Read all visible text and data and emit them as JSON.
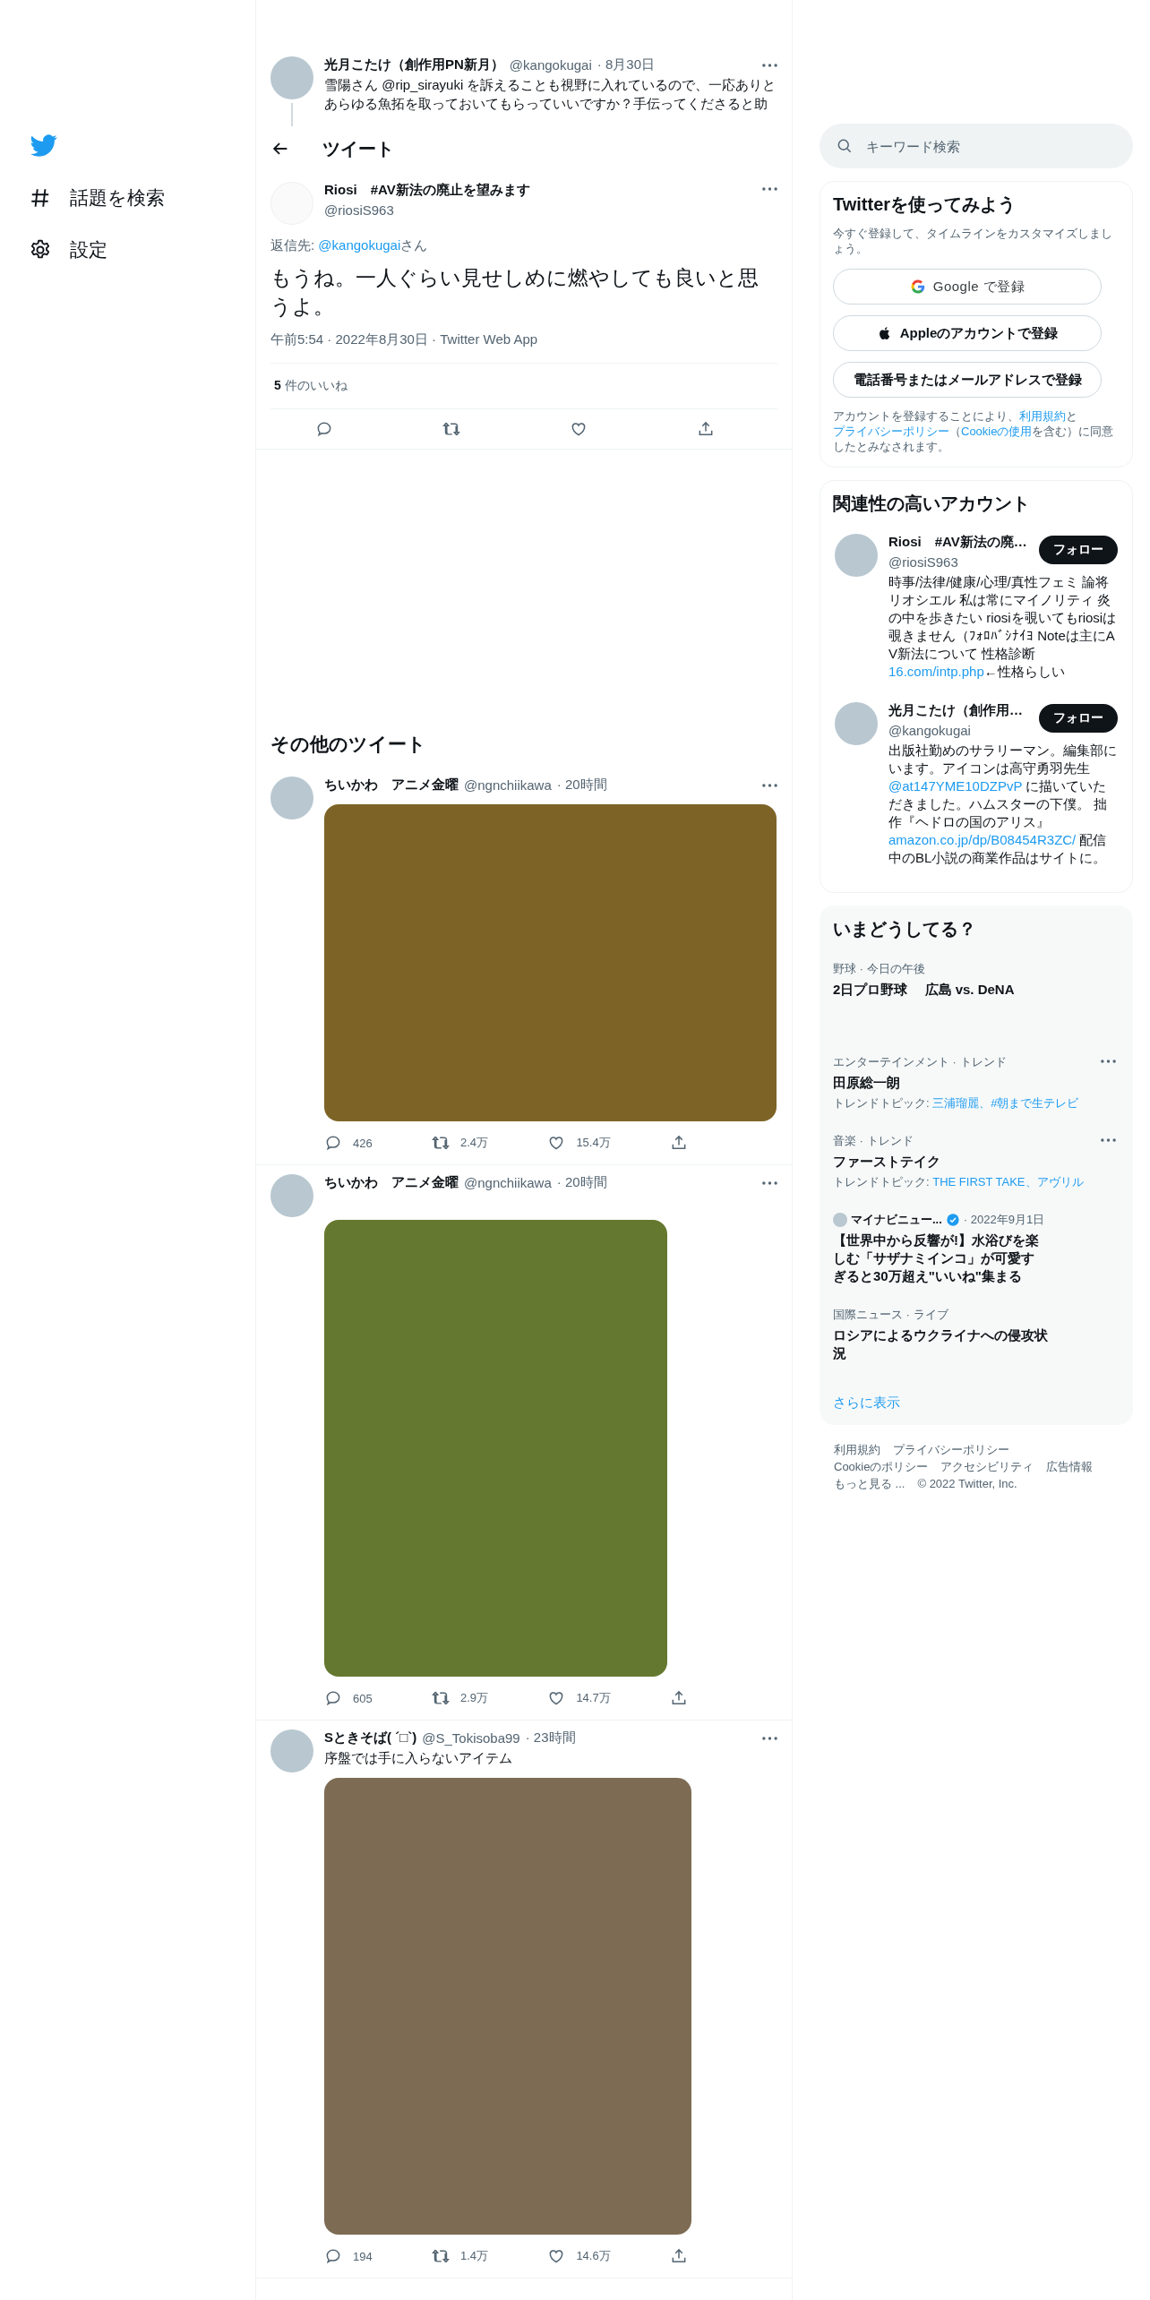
{
  "sidebar": {
    "items": [
      {
        "kind": "explore",
        "label": "話題を検索"
      },
      {
        "kind": "settings",
        "label": "設定"
      }
    ]
  },
  "parent_tweet": {
    "name": "光月こたけ（創作用PN新月）",
    "handle": "@kangokugai",
    "date": "· 8月30日",
    "text": "雪陽さん @rip_sirayuki を訴えることも視野に入れているので、一応ありとあらゆる魚拓を取っておいてもらっていいですか？手伝ってくださると助"
  },
  "header": {
    "title": "ツイート"
  },
  "main_tweet": {
    "name": "Riosi　#AV新法の廃止を望みます",
    "handle": "@riosiS963",
    "reply_prefix": "返信先: ",
    "reply_handle": "@kangokugai",
    "reply_suffix": "さん",
    "text": "もうね。一人ぐらい見せしめに燃やしても良いと思うよ。",
    "meta": "午前5:54 · 2022年8月30日 · Twitter Web App",
    "likes_count": "5",
    "likes_label": "件のいいね"
  },
  "more_tweets": {
    "title": "その他のツイート",
    "tweets": [
      {
        "name": "ちいかわ　アニメ金曜",
        "handle": "@ngnchiikawa",
        "time": "· 20時間",
        "media": {
          "color": "#7d6426"
        },
        "replies": "426",
        "retweets": "2.4万",
        "likes": "15.4万"
      },
      {
        "name": "ちいかわ　アニメ金曜",
        "handle": "@ngnchiikawa",
        "time": "· 20時間",
        "media": {
          "color": "#65782f"
        },
        "replies": "605",
        "retweets": "2.9万",
        "likes": "14.7万"
      },
      {
        "name": "Sときそば( ´□`)",
        "handle": "@S_Tokisoba99",
        "time": "· 23時間",
        "text": "序盤では手に入らないアイテム",
        "media": {
          "color": "#7d6b53"
        },
        "replies": "194",
        "retweets": "1.4万",
        "likes": "14.6万"
      }
    ]
  },
  "search": {
    "placeholder": "キーワード検索"
  },
  "signup": {
    "title": "Twitterを使ってみよう",
    "subtitle": "今すぐ登録して、タイムラインをカスタマイズしましょう。",
    "buttons": [
      {
        "kind": "google",
        "label": "Google で登録"
      },
      {
        "kind": "apple",
        "label": "Appleのアカウントで登録"
      },
      {
        "kind": "phone",
        "label": "電話番号またはメールアドレスで登録"
      }
    ],
    "legal": [
      {
        "text": "アカウントを登録することにより、",
        "link": false
      },
      {
        "text": "利用規約",
        "link": true
      },
      {
        "text": "と",
        "link": false
      },
      {
        "text": "プライバシーポリシー",
        "link": true
      },
      {
        "text": "（",
        "link": false
      },
      {
        "text": "Cookieの使用",
        "link": true
      },
      {
        "text": "を含む）に同意したとみなされます。",
        "link": false
      }
    ]
  },
  "who_to_follow": {
    "title": "関連性の高いアカウント",
    "accounts": [
      {
        "name": "Riosi　#AV新法の廃…",
        "handle": "@riosiS963",
        "button": "フォロー",
        "bio": [
          {
            "text": "時事/法律/健康/心理/真性フェミ 論将リオシエル 私は常にマイノリティ 炎の中を歩きたい riosiを覗いてもriosiは覗きません（ﾌｫﾛﾊﾞｼﾅｲﾖ Noteは主にAV新法について 性格診断",
            "link": false
          },
          {
            "text": "16.com/intp.php",
            "link": true
          },
          {
            "text": "←性格らしい",
            "link": false
          }
        ]
      },
      {
        "name": "光月こたけ（創作用…",
        "handle": "@kangokugai",
        "button": "フォロー",
        "bio": [
          {
            "text": "出版社勤めのサラリーマン。編集部にいます。アイコンは高守勇羽先生 ",
            "link": false
          },
          {
            "text": "@at147YME10DZPvP",
            "link": true
          },
          {
            "text": " に描いていただきました。ハムスターの下僕。 拙作『ヘドロの国のアリス』",
            "link": false
          },
          {
            "text": "amazon.co.jp/dp/B08454R3ZC/",
            "link": true
          },
          {
            "text": " 配信中のBL小説の商業作品はサイトに。",
            "link": false
          }
        ]
      }
    ]
  },
  "trends": {
    "title": "いまどうしてる？",
    "items": [
      {
        "kind": "trend",
        "context": "野球 · 今日の午後",
        "title": "2日プロ野球　 広島 vs. DeNA",
        "more": false
      },
      {
        "kind": "trend",
        "context": "エンターテインメント · トレンド",
        "title": "田原総一朗",
        "topics_label": "トレンドトピック: ",
        "topics": "三浦瑠麗、#朝まで生テレビ",
        "more": true
      },
      {
        "kind": "trend",
        "context": "音楽 · トレンド",
        "title": "ファーストテイク",
        "topics_label": "トレンドトピック: ",
        "topics": "THE FIRST TAKE、アヴリル",
        "more": true
      },
      {
        "kind": "news",
        "source": "マイナビニュー...",
        "verified": true,
        "date": "· 2022年9月1日",
        "title": "【世界中から反響が!】水浴びを楽しむ「サザナミインコ」が可愛すぎると30万超え\"いいね\"集まる",
        "more": false
      },
      {
        "kind": "trend",
        "context": "国際ニュース · ライブ",
        "title": "ロシアによるウクライナへの侵攻状況",
        "more": false
      }
    ],
    "show_more": "さらに表示"
  },
  "footer": {
    "rows": [
      [
        "利用規約",
        "プライバシーポリシー"
      ],
      [
        "Cookieのポリシー",
        "アクセシビリティ",
        "広告情報"
      ],
      [
        "もっと見る ...",
        "© 2022 Twitter, Inc."
      ]
    ]
  }
}
